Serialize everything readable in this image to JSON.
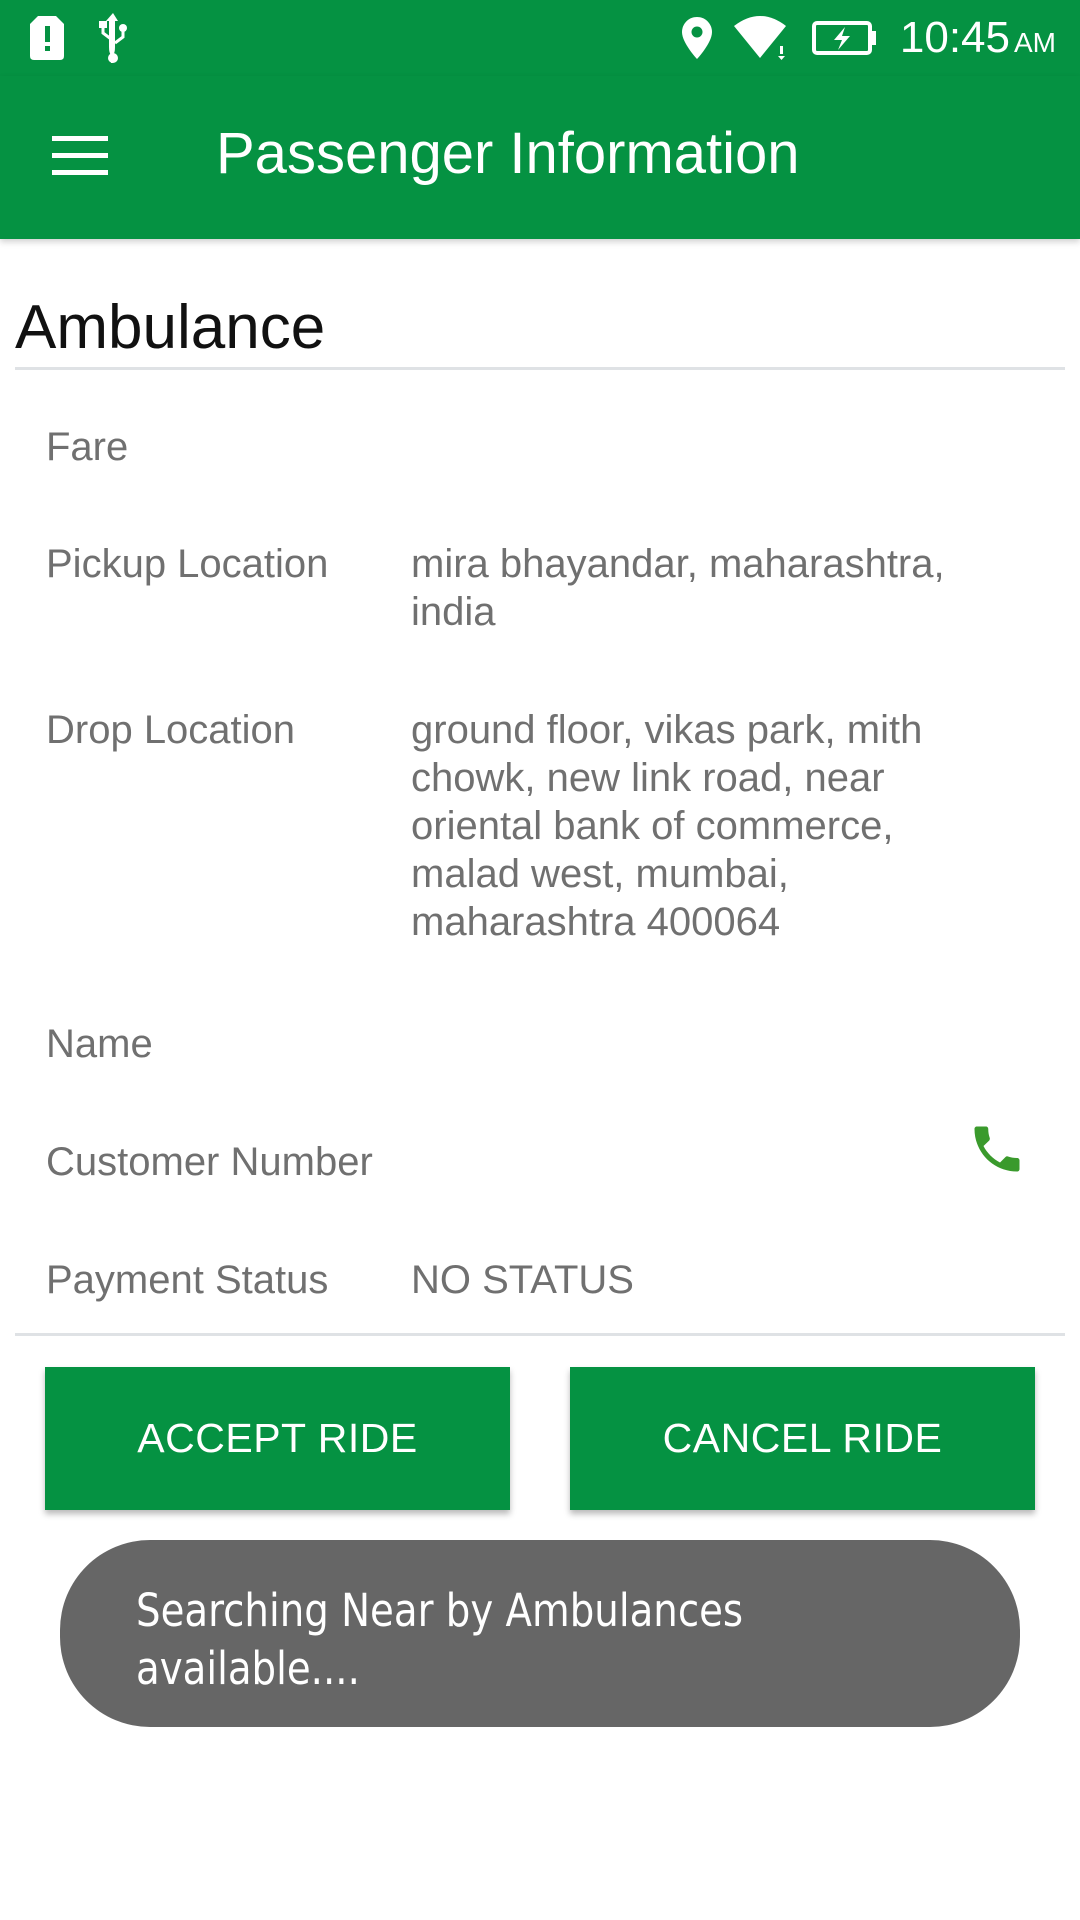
{
  "status_bar": {
    "time": "10:45",
    "ampm": "AM",
    "icons": [
      "alert-icon",
      "usb-icon",
      "location-icon",
      "wifi-icon",
      "battery-charging-icon"
    ]
  },
  "app_bar": {
    "title": "Passenger Information",
    "menu_icon": "hamburger-menu-icon"
  },
  "section": {
    "heading": "Ambulance"
  },
  "details": {
    "fare": {
      "label": "Fare",
      "value": ""
    },
    "pickup": {
      "label": "Pickup Location",
      "value": "mira bhayandar, maharashtra, india"
    },
    "drop": {
      "label": "Drop Location",
      "value": "ground floor, vikas park, mith chowk, new link road, near oriental bank of commerce, malad west, mumbai, maharashtra 400064"
    },
    "name": {
      "label": "Name",
      "value": ""
    },
    "customer_number": {
      "label": "Customer Number",
      "value": "",
      "icon": "phone-icon"
    },
    "payment_status": {
      "label": "Payment Status",
      "value": "NO STATUS"
    }
  },
  "actions": {
    "accept_label": "ACCEPT RIDE",
    "cancel_label": "CANCEL RIDE"
  },
  "toast": {
    "message": "Searching Near by Ambulances available...."
  },
  "colors": {
    "primary": "#059242",
    "phone_icon": "#3a9a2c",
    "toast_bg": "#666666",
    "label_text": "#707070"
  }
}
